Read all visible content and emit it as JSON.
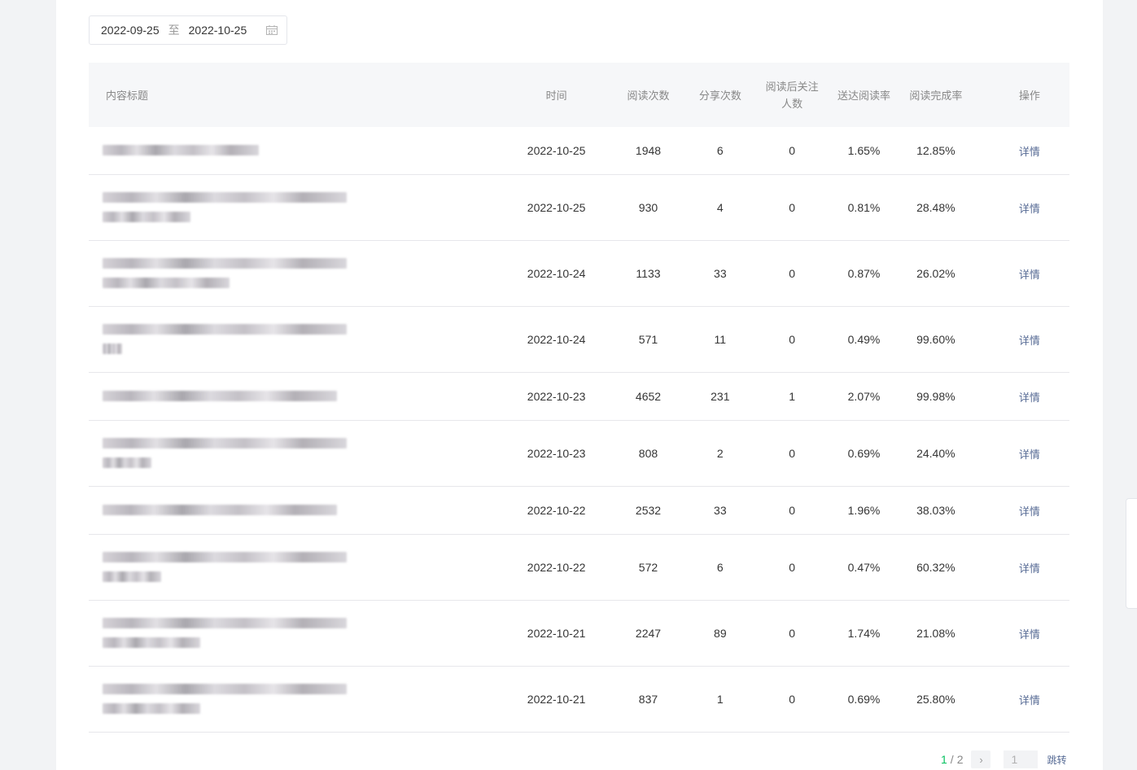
{
  "date_range": {
    "start": "2022-09-25",
    "separator": "至",
    "end": "2022-10-25",
    "icon": "calendar-icon"
  },
  "table": {
    "headers": {
      "title": "内容标题",
      "time": "时间",
      "reads": "阅读次数",
      "shares": "分享次数",
      "follows": "阅读后关注人数",
      "follows_line1": "阅读后关注",
      "follows_line2": "人数",
      "delivery_rate": "送达阅读率",
      "completion_rate": "阅读完成率",
      "action": "操作"
    },
    "rows": [
      {
        "time": "2022-10-25",
        "reads": "1948",
        "shares": "6",
        "follows": "0",
        "delivery_rate": "1.65%",
        "completion_rate": "12.85%",
        "action": "详情"
      },
      {
        "time": "2022-10-25",
        "reads": "930",
        "shares": "4",
        "follows": "0",
        "delivery_rate": "0.81%",
        "completion_rate": "28.48%",
        "action": "详情"
      },
      {
        "time": "2022-10-24",
        "reads": "1133",
        "shares": "33",
        "follows": "0",
        "delivery_rate": "0.87%",
        "completion_rate": "26.02%",
        "action": "详情"
      },
      {
        "time": "2022-10-24",
        "reads": "571",
        "shares": "11",
        "follows": "0",
        "delivery_rate": "0.49%",
        "completion_rate": "99.60%",
        "action": "详情"
      },
      {
        "time": "2022-10-23",
        "reads": "4652",
        "shares": "231",
        "follows": "1",
        "delivery_rate": "2.07%",
        "completion_rate": "99.98%",
        "action": "详情"
      },
      {
        "time": "2022-10-23",
        "reads": "808",
        "shares": "2",
        "follows": "0",
        "delivery_rate": "0.69%",
        "completion_rate": "24.40%",
        "action": "详情"
      },
      {
        "time": "2022-10-22",
        "reads": "2532",
        "shares": "33",
        "follows": "0",
        "delivery_rate": "1.96%",
        "completion_rate": "38.03%",
        "action": "详情"
      },
      {
        "time": "2022-10-22",
        "reads": "572",
        "shares": "6",
        "follows": "0",
        "delivery_rate": "0.47%",
        "completion_rate": "60.32%",
        "action": "详情"
      },
      {
        "time": "2022-10-21",
        "reads": "2247",
        "shares": "89",
        "follows": "0",
        "delivery_rate": "1.74%",
        "completion_rate": "21.08%",
        "action": "详情"
      },
      {
        "time": "2022-10-21",
        "reads": "837",
        "shares": "1",
        "follows": "0",
        "delivery_rate": "0.69%",
        "completion_rate": "25.80%",
        "action": "详情"
      }
    ]
  },
  "pagination": {
    "current": "1",
    "separator": "/",
    "total": "2",
    "next_icon": "chevron-right-icon",
    "input_value": "1",
    "jump_label": "跳转"
  },
  "colors": {
    "link": "#576b95",
    "current_page": "#07c160",
    "header_bg": "#f6f7f9"
  }
}
